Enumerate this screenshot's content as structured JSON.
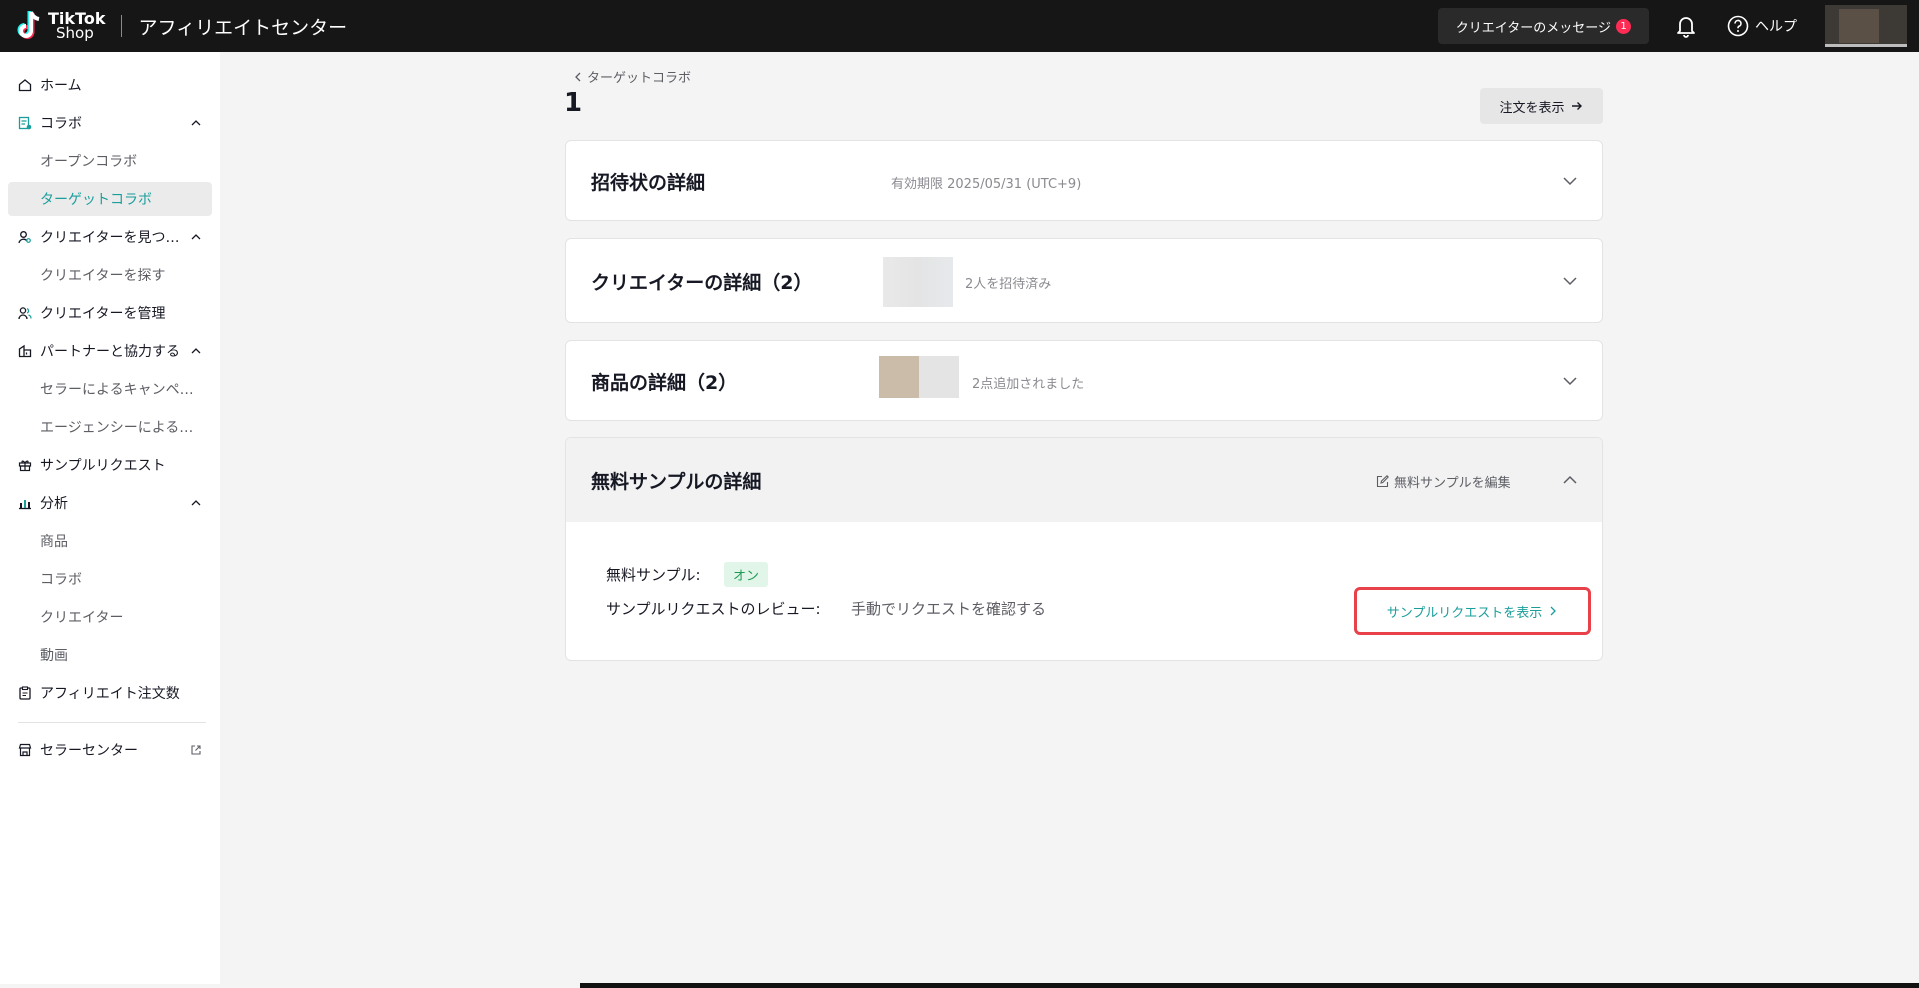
{
  "header": {
    "logo_line1": "TikTok",
    "logo_line2": "Shop",
    "app_title": "アフィリエイトセンター",
    "messages_label": "クリエイターのメッセージ",
    "messages_count": "1",
    "help_label": "ヘルプ"
  },
  "sidebar": {
    "home": "ホーム",
    "collab": "コラボ",
    "open_collab": "オープンコラボ",
    "target_collab": "ターゲットコラボ",
    "find_creators_group": "クリエイターを見つ…",
    "find_creators": "クリエイターを探す",
    "manage_creators": "クリエイターを管理",
    "partners": "パートナーと協力する",
    "seller_campaign": "セラーによるキャンペ…",
    "agency": "エージェンシーによる…",
    "sample_requests": "サンプルリクエスト",
    "analytics": "分析",
    "analytics_products": "商品",
    "analytics_collab": "コラボ",
    "analytics_creators": "クリエイター",
    "analytics_videos": "動画",
    "affiliate_orders": "アフィリエイト注文数",
    "seller_center": "セラーセンター"
  },
  "main": {
    "breadcrumb": "ターゲットコラボ",
    "page_number": "1",
    "view_orders": "注文を表示",
    "invitation": {
      "title": "招待状の詳細",
      "meta": "有効期限 2025/05/31 (UTC+9)"
    },
    "creators": {
      "title": "クリエイターの詳細（2）",
      "meta": "2人を招待済み"
    },
    "products": {
      "title": "商品の詳細（2）",
      "meta": "2点追加されました"
    },
    "samples": {
      "title": "無料サンプルの詳細",
      "edit_label": "無料サンプルを編集",
      "free_sample_label": "無料サンプル:",
      "free_sample_value": "オン",
      "review_label": "サンプルリクエストのレビュー:",
      "review_value": "手動でリクエストを確認する",
      "view_requests": "サンプルリクエストを表示"
    }
  },
  "colors": {
    "accent": "#1a9e9b",
    "highlight": "#e8414a",
    "topbar": "#161616"
  }
}
